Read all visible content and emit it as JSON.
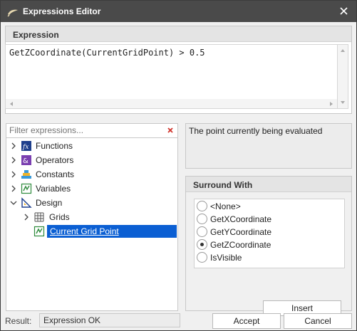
{
  "window": {
    "title": "Expressions Editor",
    "title_bar_color": "#4a4a4a"
  },
  "expression": {
    "header": "Expression",
    "text": "GetZCoordinate(CurrentGridPoint) > 0.5"
  },
  "filter": {
    "placeholder": "Filter expressions..."
  },
  "tree": {
    "items": [
      {
        "label": "Functions",
        "icon": "function-icon",
        "expanded": false
      },
      {
        "label": "Operators",
        "icon": "operators-icon",
        "expanded": false
      },
      {
        "label": "Constants",
        "icon": "constants-icon",
        "expanded": false
      },
      {
        "label": "Variables",
        "icon": "variables-icon",
        "expanded": false
      },
      {
        "label": "Design",
        "icon": "design-icon",
        "expanded": true
      },
      {
        "label": "Grids",
        "icon": "grid-icon",
        "expanded": false
      },
      {
        "label": "Current Grid Point",
        "icon": "grid-point-icon",
        "selected": true
      }
    ]
  },
  "description": {
    "text": "The point currently being evaluated"
  },
  "surround": {
    "header": "Surround With",
    "options": [
      "<None>",
      "GetXCoordinate",
      "GetYCoordinate",
      "GetZCoordinate",
      "IsVisible"
    ],
    "selected": "GetZCoordinate",
    "insert_label": "Insert"
  },
  "footer": {
    "result_label": "Result:",
    "result_value": "Expression OK",
    "accept_label": "Accept",
    "cancel_label": "Cancel"
  },
  "colors": {
    "selection": "#0b5fd3",
    "clear_icon": "#d0342c"
  }
}
